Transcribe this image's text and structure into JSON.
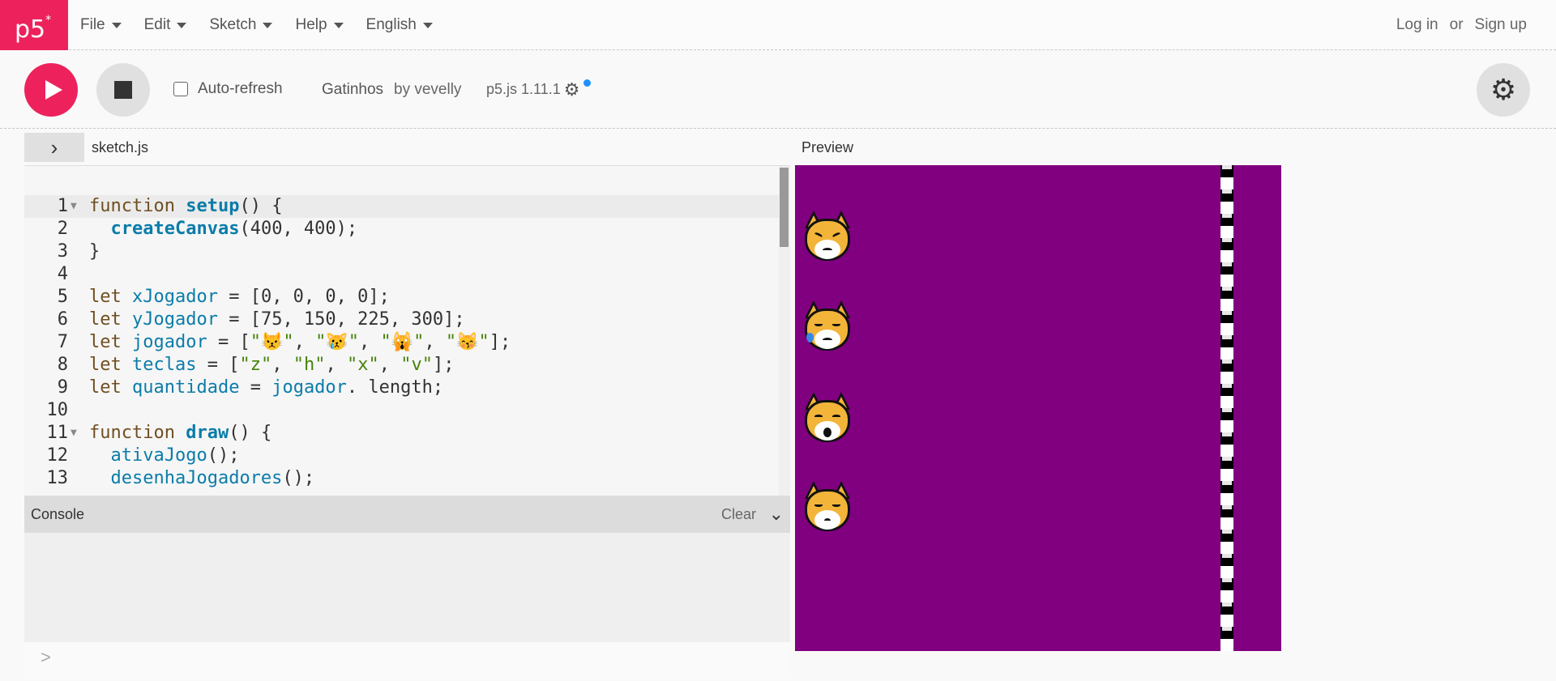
{
  "nav": {
    "logo": "p5",
    "logo_sup": "*",
    "menu": [
      "File",
      "Edit",
      "Sketch",
      "Help",
      "English"
    ],
    "login": "Log in",
    "or": "or",
    "signup": "Sign up"
  },
  "toolbar": {
    "auto_refresh": "Auto-refresh",
    "sketch_name": "Gatinhos",
    "by": "by vevelly",
    "version": "p5.js 1.11.1"
  },
  "editor": {
    "file_name": "sketch.js",
    "active_line": 1
  },
  "console": {
    "title": "Console",
    "clear": "Clear",
    "prompt": ">"
  },
  "preview": {
    "label": "Preview",
    "canvas_color": "#800080",
    "players": [
      "angry-cat",
      "crying-cat",
      "weary-cat",
      "kissing-cat"
    ]
  },
  "colors": {
    "accent": "#ed225d",
    "keyword": "#704f21",
    "function": "#0b7ca9",
    "string": "#47820a"
  }
}
